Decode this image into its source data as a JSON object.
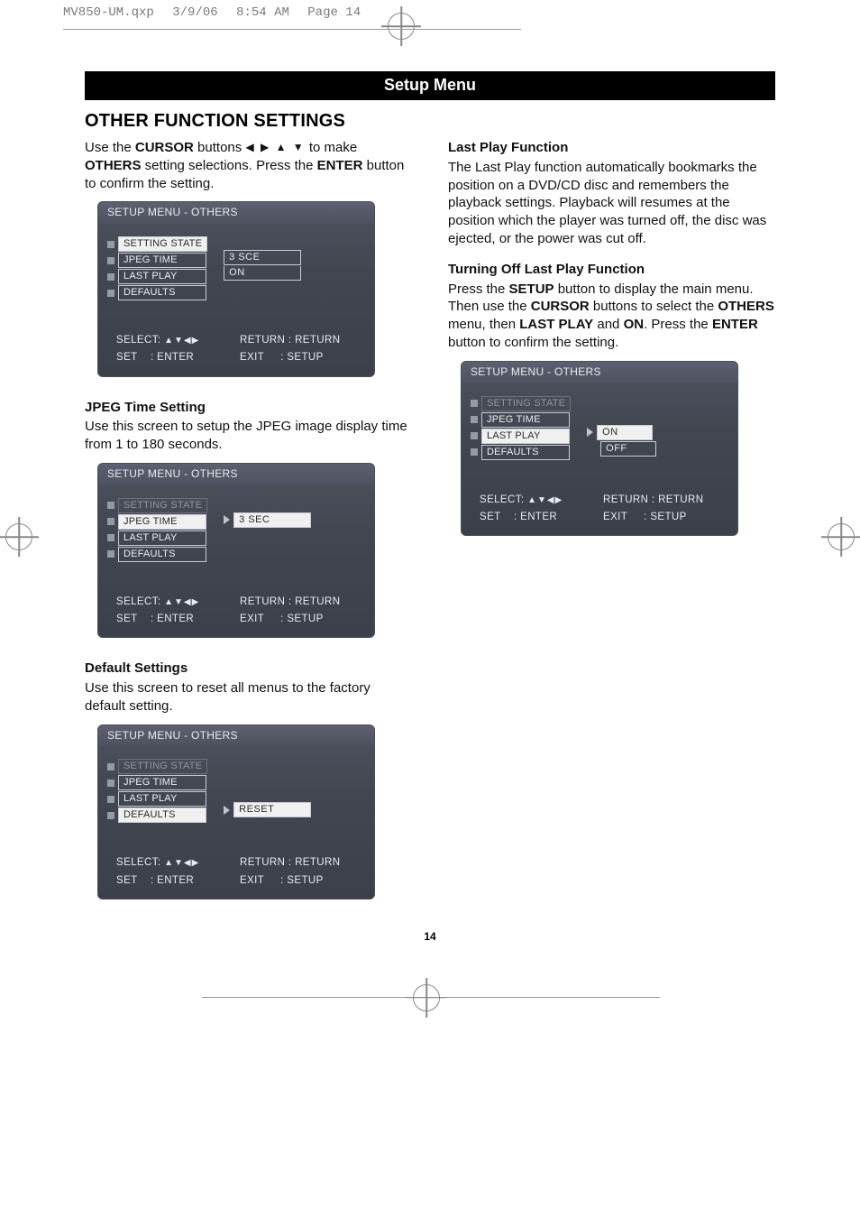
{
  "print_info": {
    "file": "MV850-UM.qxp",
    "date": "3/9/06",
    "time": "8:54 AM",
    "page_label": "Page 14"
  },
  "banner": "Setup Menu",
  "section_title": "OTHER FUNCTION SETTINGS",
  "intro": {
    "p1a": "Use the ",
    "p1b_bold": "CURSOR",
    "p1c": " buttons  ",
    "arrows": "◀ ▶ ▲ ▼",
    "p1d": "  to make ",
    "p2a_bold": "OTHERS",
    "p2b": " setting selections. Press the ",
    "p2c_bold": "ENTER",
    "p2d": " button to confirm the setting."
  },
  "osd": {
    "title": "SETUP MENU - OTHERS",
    "items": [
      "SETTING STATE",
      "JPEG TIME",
      "LAST PLAY",
      "DEFAULTS"
    ],
    "footer": {
      "select": "SELECT:",
      "select_arrows": "▲▼◀▶",
      "return": "RETURN : RETURN",
      "set_label": "SET",
      "set_value": ": ENTER",
      "exit_label": "EXIT",
      "exit_value": ": SETUP"
    }
  },
  "box1": {
    "values": {
      "v1": "3 SCE",
      "v2": "ON"
    }
  },
  "jpeg": {
    "heading": "JPEG Time Setting",
    "body": "Use this screen to setup the JPEG image display time from 1 to 180 seconds.",
    "value": "3  SEC"
  },
  "defaults": {
    "heading": "Default Settings",
    "body": "Use this screen to reset all menus to the factory default setting.",
    "value": "RESET"
  },
  "lastplay": {
    "heading": "Last Play Function",
    "body": "The Last Play function automatically bookmarks the position on a DVD/CD disc and remembers the playback settings. Playback will resumes at the position which the player was turned off, the disc was ejected, or the power was cut off."
  },
  "turnoff": {
    "heading": "Turning Off Last Play Function",
    "p1a": "Press the ",
    "p1b_bold": "SETUP",
    "p1c": " button to display the main menu. Then use the ",
    "p1d_bold": "CURSOR",
    "p1e": " buttons to select the ",
    "p1f_bold": "OTHERS",
    "p1g": " menu, then ",
    "p1h_bold": "LAST PLAY",
    "p1i": " and ",
    "p1j_bold": "ON",
    "p1k": ". Press the ",
    "p1l_bold": "ENTER",
    "p1m": " button to confirm the setting.",
    "values": {
      "v1": "ON",
      "v2": "OFF"
    }
  },
  "page_number": "14"
}
